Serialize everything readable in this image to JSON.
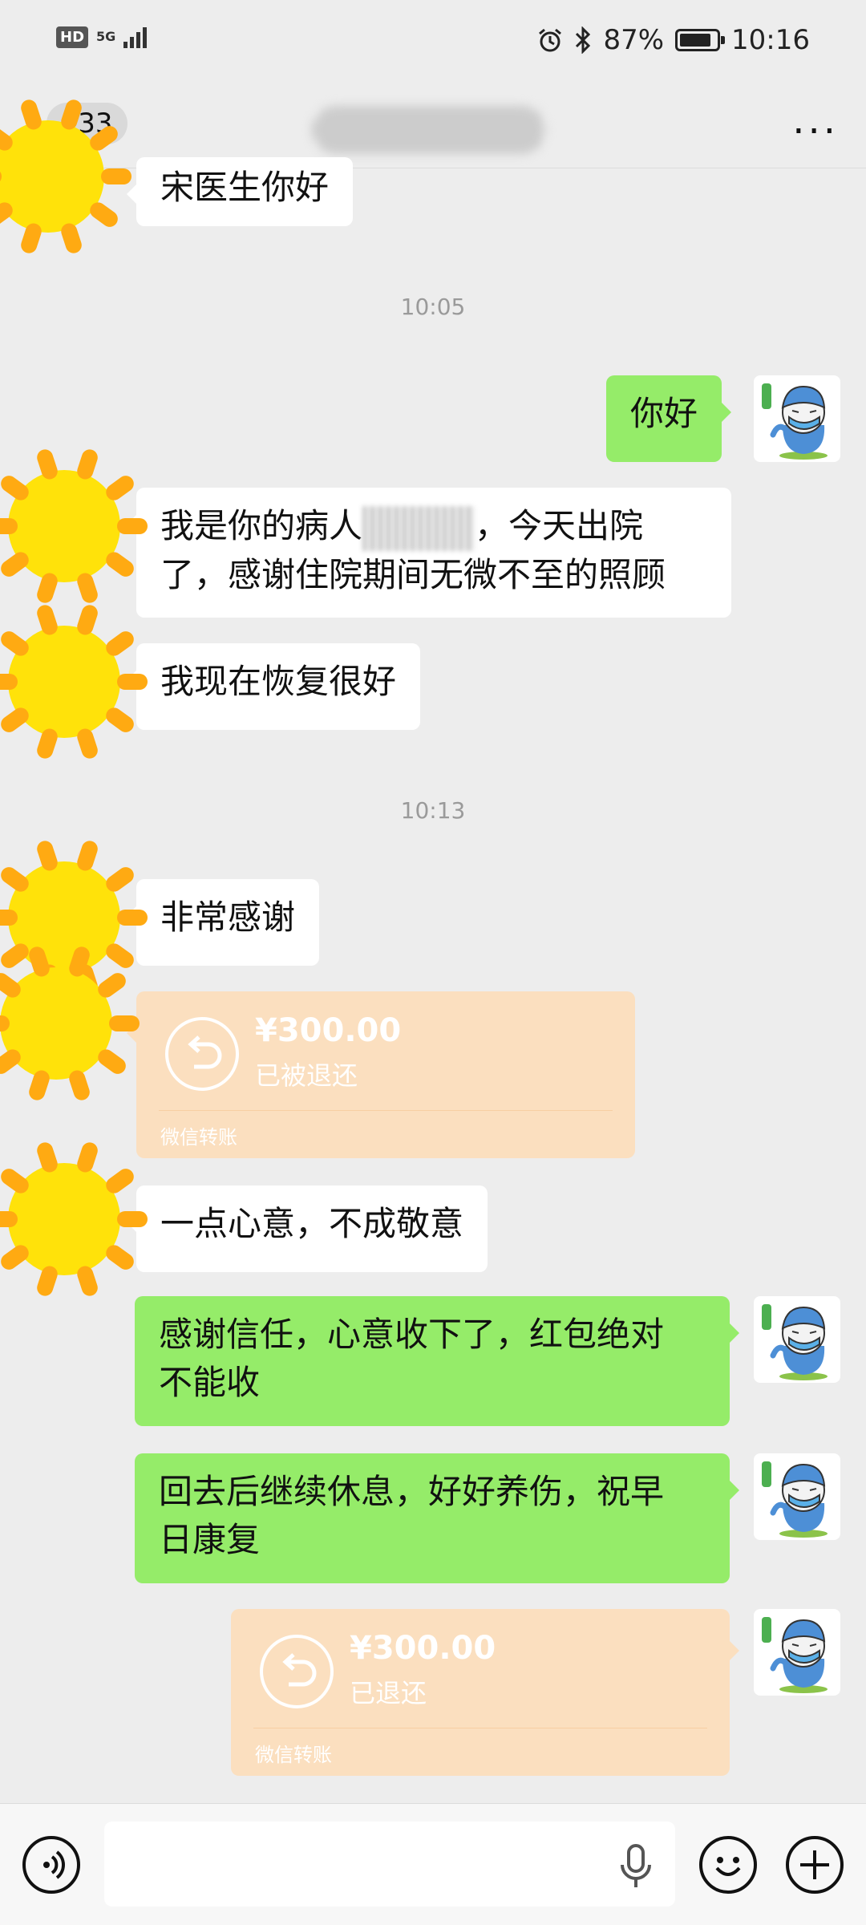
{
  "status_bar": {
    "hd": "HD",
    "network": "5G",
    "battery_percent": "87%",
    "battery_level": 0.87,
    "time": "10:16",
    "icons": [
      "alarm-icon",
      "bluetooth-icon",
      "battery-icon",
      "signal-icon"
    ]
  },
  "nav": {
    "back_icon": "chevron-left-icon",
    "unread_count": "133",
    "more_icon": "more-dots-icon"
  },
  "messages": {
    "m1": "宋医生你好",
    "t1": "10:05",
    "m2": "你好",
    "m3_a": "我是你的病人",
    "m3_b": "，今天出院",
    "m3_c": "了，感谢住院期间无微不至的照顾",
    "m4": "我现在恢复很好",
    "t2": "10:13",
    "m5": "非常感谢",
    "transfer1": {
      "amount": "¥300.00",
      "status": "已被退还",
      "label": "微信转账"
    },
    "m6": "一点心意，不成敬意",
    "m7_a": "感谢信任，心意收下了，红包绝对",
    "m7_b": "不能收",
    "m8_a": "回去后继续休息，好好养伤，祝早",
    "m8_b": "日康复",
    "transfer2": {
      "amount": "¥300.00",
      "status": "已退还",
      "label": "微信转账"
    }
  },
  "input_bar": {
    "voice_icon": "voice-icon",
    "mic_icon": "mic-icon",
    "emoji_icon": "emoji-icon",
    "plus_icon": "plus-icon",
    "placeholder": ""
  },
  "colors": {
    "background": "#ededed",
    "outgoing_bubble": "#95ec69",
    "incoming_bubble": "#ffffff",
    "transfer_card": "#fbdfbf",
    "sun_core": "#ffe20a",
    "sun_ray": "#ffaa12"
  }
}
